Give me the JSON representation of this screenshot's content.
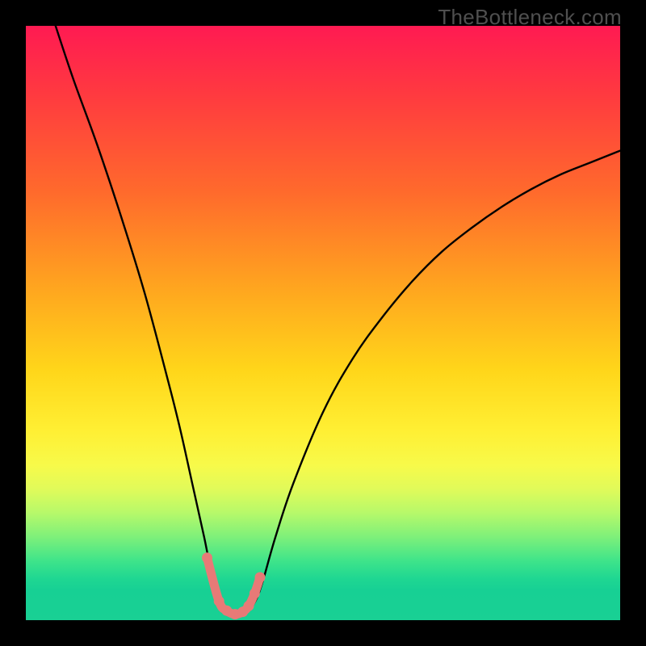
{
  "brand": "TheBottleneck.com",
  "colors": {
    "frame": "#000000",
    "curve": "#000000",
    "marker": "#e77a77",
    "brand_text": "#4f4f4f"
  },
  "chart_data": {
    "type": "line",
    "title": "",
    "xlabel": "",
    "ylabel": "",
    "xlim": [
      0,
      100
    ],
    "ylim": [
      0,
      100
    ],
    "grid": false,
    "legend": false,
    "series": [
      {
        "name": "bottleneck-curve",
        "x": [
          5,
          8,
          12,
          16,
          20,
          24,
          26,
          28,
          30,
          31,
          32,
          33,
          34,
          35,
          36,
          37,
          38,
          39,
          40,
          42,
          45,
          50,
          55,
          60,
          65,
          70,
          75,
          80,
          85,
          90,
          95,
          100
        ],
        "y": [
          100,
          91,
          80,
          68,
          55,
          40,
          32,
          23,
          14,
          9,
          5,
          2.5,
          1.5,
          1,
          1,
          1.3,
          2.2,
          4,
          7,
          14,
          23,
          35,
          44,
          51,
          57,
          62,
          66,
          69.5,
          72.5,
          75,
          77,
          79
        ]
      }
    ],
    "markers": {
      "name": "optimal-region",
      "x": [
        30.5,
        32.5,
        33.8,
        35.2,
        36.5,
        37.5,
        38.5,
        39.4
      ],
      "y": [
        10.5,
        3.2,
        1.6,
        1,
        1.4,
        2.4,
        4.5,
        7.2
      ],
      "r": [
        1.6,
        1.6,
        1.6,
        1.6,
        1.6,
        1.6,
        1.6,
        1.6
      ]
    }
  }
}
